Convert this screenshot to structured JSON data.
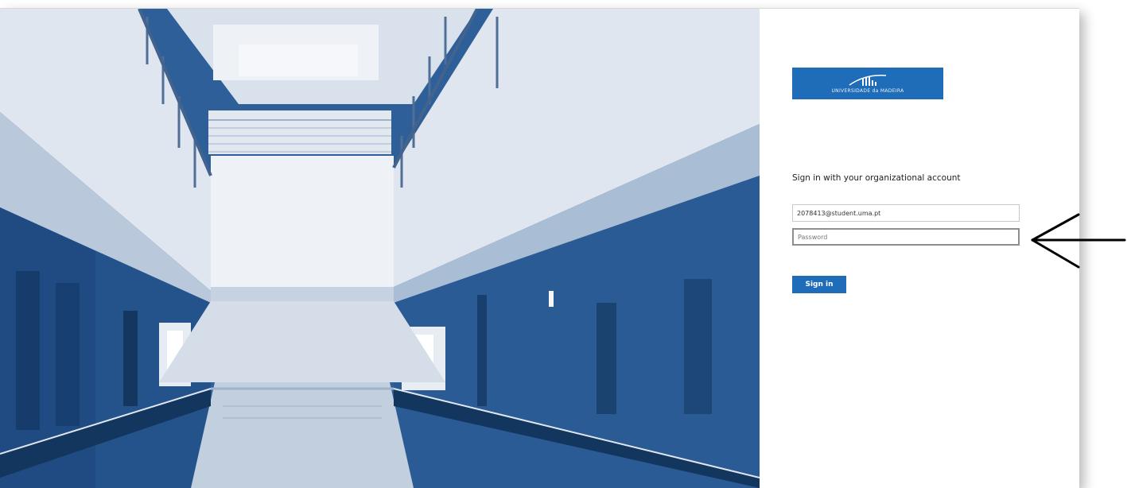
{
  "logo": {
    "text": "UNIVERSIDADE da MADEIRA"
  },
  "signin_form": {
    "heading": "Sign in with your organizational account",
    "username_value": "2078413@student.uma.pt",
    "password_placeholder": "Password",
    "submit_label": "Sign in"
  },
  "colors": {
    "brand_blue": "#1f6cb8",
    "photo_tint": "#2d5d97"
  },
  "annotation": {
    "icon": "left-arrow-icon",
    "target": "password-field"
  }
}
